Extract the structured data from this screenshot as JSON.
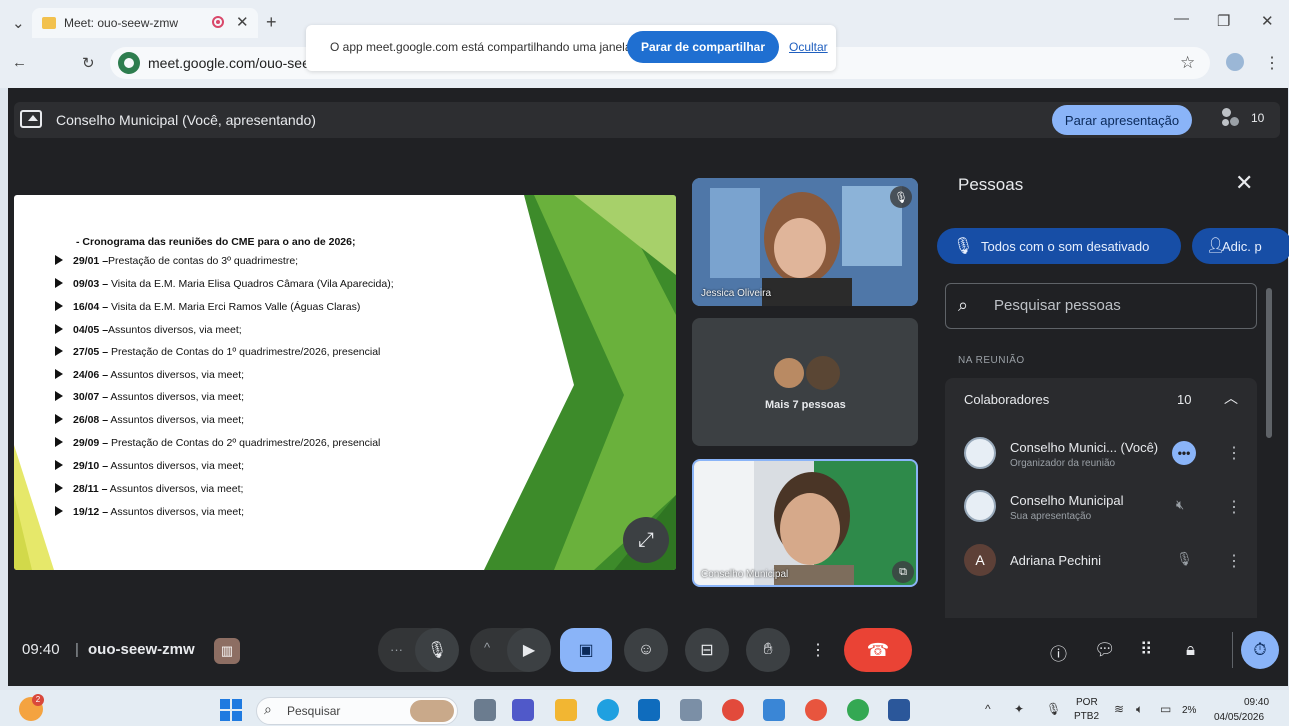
{
  "browser": {
    "tab_title": "Meet: ouo-seew-zmw",
    "url": "meet.google.com/ouo-seew",
    "share_message": "O app meet.google.com está compartilhando uma janela.",
    "stop_sharing_label": "Parar de compartilhar",
    "hide_label": "Ocultar"
  },
  "meet": {
    "presentation_title": "Conselho Municipal (Você, apresentando)",
    "stop_presenting_label": "Parar apresentação",
    "participant_count": "10",
    "slide": {
      "heading": "- Cronograma das reuniões do CME para o ano de 2026;",
      "items": [
        {
          "date": "29/01 –",
          "text": "Prestação de contas do 3º quadrimestre;"
        },
        {
          "date": "09/03 –",
          "text": " Visita da E.M. Maria Elisa Quadros Câmara (Vila Aparecida);"
        },
        {
          "date": "16/04 –",
          "text": " Visita da E.M. Maria Erci Ramos Valle (Águas Claras)"
        },
        {
          "date": "04/05 –",
          "text": "Assuntos diversos, via meet;"
        },
        {
          "date": "27/05 –",
          "text": " Prestação de Contas do 1º quadrimestre/2026, presencial"
        },
        {
          "date": "24/06 –",
          "text": " Assuntos diversos, via meet;"
        },
        {
          "date": "30/07 –",
          "text": " Assuntos diversos, via meet;"
        },
        {
          "date": "26/08 –",
          "text": " Assuntos diversos, via meet;"
        },
        {
          "date": "29/09 –",
          "text": " Prestação de Contas do 2º quadrimestre/2026, presencial"
        },
        {
          "date": "29/10 –",
          "text": " Assuntos diversos, via meet;"
        },
        {
          "date": "28/11 –",
          "text": " Assuntos diversos, via meet;"
        },
        {
          "date": "19/12 –",
          "text": " Assuntos diversos, via meet;"
        }
      ]
    },
    "tiles": {
      "tile1_name": "Jessica Oliveira",
      "more_people": "Mais 7 pessoas",
      "tile3_name": "Conselho Municipal"
    },
    "panel": {
      "title": "Pessoas",
      "mute_all": "Todos com o som desativado",
      "add": "Adic. p",
      "search_placeholder": "Pesquisar pessoas",
      "section_label": "NA REUNIÃO",
      "collaborators_label": "Colaboradores",
      "collaborators_count": "10",
      "people": [
        {
          "name": "Conselho Munici... (Você)",
          "sub": "Organizador da reunião"
        },
        {
          "name": "Conselho Municipal",
          "sub": "Sua apresentação"
        },
        {
          "name": "Adriana Pechini",
          "sub": "",
          "initial": "A"
        }
      ]
    },
    "bottom": {
      "time": "09:40",
      "separator": "|",
      "code": "ouo-seew-zmw"
    }
  },
  "taskbar": {
    "search_label": "Pesquisar",
    "lang_line1": "POR",
    "lang_line2": "PTB2",
    "battery": "2%",
    "clock_time": "09:40",
    "clock_date": "04/05/2026",
    "notif_badge": "2"
  },
  "colors": {
    "meet_bg": "#202124",
    "accent_blue": "#8ab4f8",
    "end_call_red": "#ea4335",
    "slide_green": "#5aa53a"
  }
}
